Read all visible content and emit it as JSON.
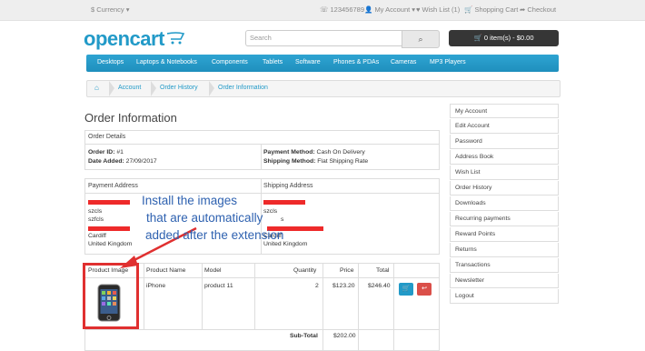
{
  "topbar": {
    "currency": "$ Currency",
    "phone": "123456789",
    "my_account": "My Account",
    "wish_list": "Wish List (1)",
    "shopping_cart": "Shopping Cart",
    "checkout": "Checkout"
  },
  "header": {
    "logo": "opencart",
    "search_placeholder": "Search",
    "cart_button": "0 item(s) - $0.00"
  },
  "menu": [
    "Desktops",
    "Laptops & Notebooks",
    "Components",
    "Tablets",
    "Software",
    "Phones & PDAs",
    "Cameras",
    "MP3 Players"
  ],
  "breadcrumb": [
    "Account",
    "Order History",
    "Order Information"
  ],
  "page_title": "Order Information",
  "order_details": {
    "header": "Order Details",
    "order_id_label": "Order ID:",
    "order_id_value": "#1",
    "date_added_label": "Date Added:",
    "date_added_value": "27/09/2017",
    "payment_method_label": "Payment Method:",
    "payment_method_value": "Cash On Delivery",
    "shipping_method_label": "Shipping Method:",
    "shipping_method_value": "Flat Shipping Rate"
  },
  "payment_address": {
    "header": "Payment Address",
    "lines": [
      "szcls",
      "szfcls",
      "Cardiff",
      "United Kingdom"
    ]
  },
  "shipping_address": {
    "header": "Shipping Address",
    "lines": [
      "szcls",
      "s",
      "Cardiff",
      "United Kingdom"
    ]
  },
  "products_table": {
    "headers": [
      "Product Image",
      "Product Name",
      "Model",
      "Quantity",
      "Price",
      "Total"
    ],
    "rows": [
      {
        "name": "iPhone",
        "model": "product 11",
        "quantity": "2",
        "price": "$123.20",
        "total": "$246.40"
      }
    ],
    "subtotal_label": "Sub-Total",
    "subtotal_value": "$202.00"
  },
  "annotation": {
    "line1": "Install the images",
    "line2": "that are automatically",
    "line3": "added after the extension",
    "color": "#2f62b0",
    "highlight_color": "#e03030"
  },
  "sidebar": [
    "My Account",
    "Edit Account",
    "Password",
    "Address Book",
    "Wish List",
    "Order History",
    "Downloads",
    "Recurring payments",
    "Reward Points",
    "Returns",
    "Transactions",
    "Newsletter",
    "Logout"
  ],
  "icons": {
    "phone": "phone-icon",
    "user": "user-icon",
    "heart": "heart-icon",
    "cart": "cart-icon",
    "checkout": "share-icon",
    "search": "search-icon",
    "home": "home-icon",
    "reorder": "cart-icon",
    "return": "reply-icon"
  },
  "colors": {
    "accent": "#229ac8",
    "cart_button": "#363636",
    "return_button": "#da4f49"
  }
}
